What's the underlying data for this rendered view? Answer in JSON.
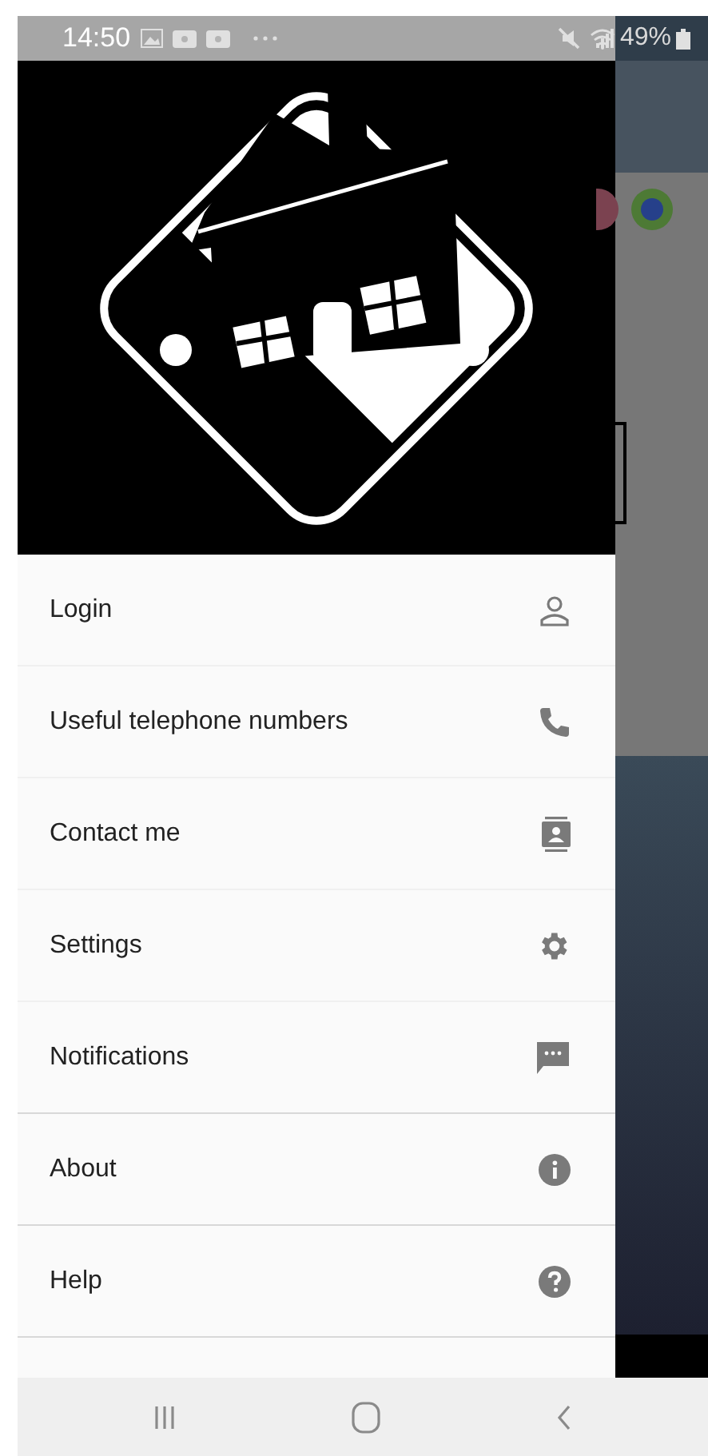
{
  "status_bar": {
    "time": "14:50",
    "battery": "49%"
  },
  "drawer": {
    "menu_items": [
      {
        "label": "Login"
      },
      {
        "label": "Useful telephone numbers"
      },
      {
        "label": "Contact me"
      },
      {
        "label": "Settings"
      },
      {
        "label": "Notifications"
      },
      {
        "label": "About"
      },
      {
        "label": "Help"
      }
    ]
  }
}
